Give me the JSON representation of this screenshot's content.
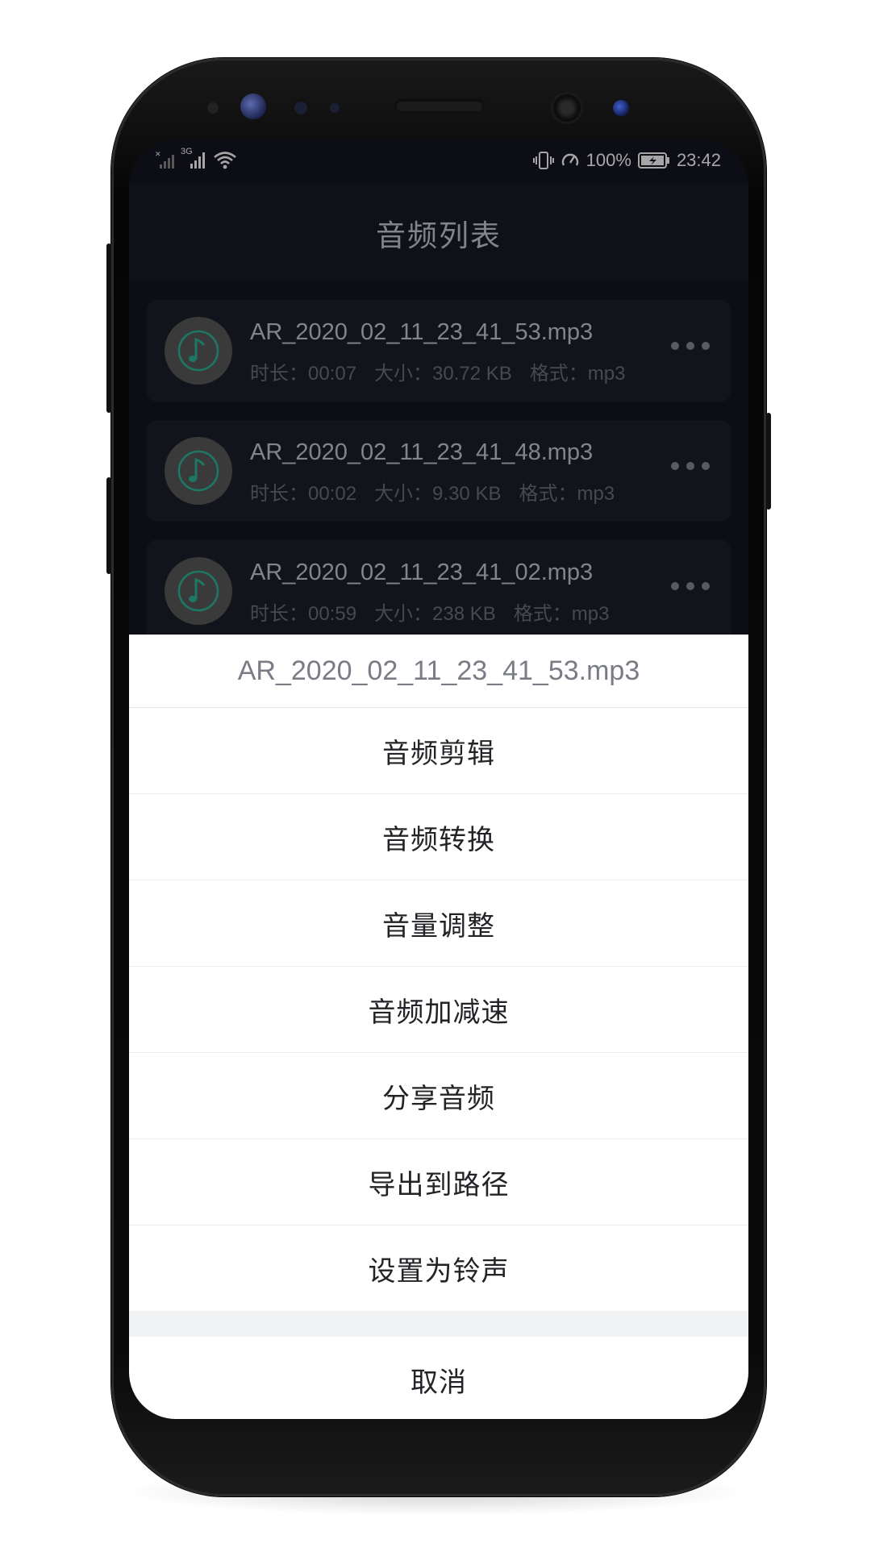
{
  "status_bar": {
    "network_label": "3G",
    "battery_percent": "100%",
    "time": "23:42"
  },
  "app_bar": {
    "title": "音频列表"
  },
  "audio_list": [
    {
      "name": "AR_2020_02_11_23_41_53.mp3",
      "duration": "时长：00:07",
      "size": "大小：30.72 KB",
      "format": "格式：mp3"
    },
    {
      "name": "AR_2020_02_11_23_41_48.mp3",
      "duration": "时长：00:02",
      "size": "大小：9.30 KB",
      "format": "格式：mp3"
    },
    {
      "name": "AR_2020_02_11_23_41_02.mp3",
      "duration": "时长：00:59",
      "size": "大小：238 KB",
      "format": "格式：mp3"
    }
  ],
  "action_sheet": {
    "title": "AR_2020_02_11_23_41_53.mp3",
    "options": [
      "音频剪辑",
      "音频转换",
      "音量调整",
      "音频加减速",
      "分享音频",
      "导出到路径",
      "设置为铃声"
    ],
    "cancel": "取消"
  },
  "colors": {
    "accent": "#2fb59b",
    "screen_bg": "#141621",
    "card_bg": "#1d1f2b",
    "sheet_bg": "#ffffff"
  },
  "icons": {
    "list_item": "music-note-icon",
    "more": "more-horizontal-icon"
  }
}
